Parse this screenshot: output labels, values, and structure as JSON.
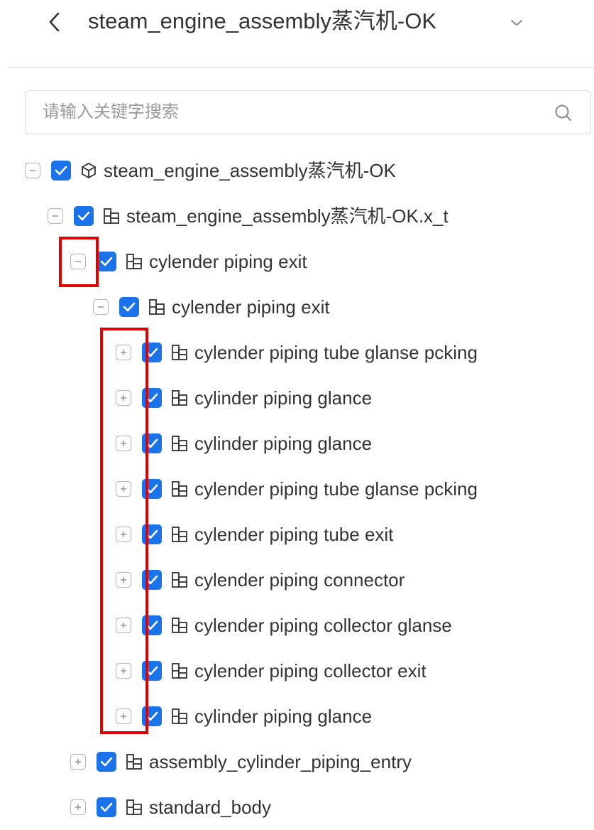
{
  "header": {
    "title": "steam_engine_assembly蒸汽机-OK",
    "back_icon": "chevron-left-icon",
    "dropdown_icon": "chevron-down-icon"
  },
  "search": {
    "placeholder": "请输入关键字搜索",
    "value": "",
    "icon": "search-icon"
  },
  "tree": {
    "checkbox_color": "#1a73e8",
    "highlight_color": "#e30000",
    "nodes": [
      {
        "label": "steam_engine_assembly蒸汽机-OK",
        "level": 0,
        "expanded": true,
        "checked": true,
        "icon": "cube-icon"
      },
      {
        "label": "steam_engine_assembly蒸汽机-OK.x_t",
        "level": 1,
        "expanded": true,
        "checked": true,
        "icon": "assembly-icon"
      },
      {
        "label": "cylender piping exit",
        "level": 2,
        "expanded": true,
        "checked": true,
        "icon": "assembly-icon"
      },
      {
        "label": "cylender piping exit",
        "level": 3,
        "expanded": true,
        "checked": true,
        "icon": "assembly-icon"
      },
      {
        "label": "cylender piping tube glanse pcking",
        "level": 4,
        "expanded": false,
        "checked": true,
        "icon": "assembly-icon"
      },
      {
        "label": "cylinder piping glance",
        "level": 4,
        "expanded": false,
        "checked": true,
        "icon": "assembly-icon"
      },
      {
        "label": "cylinder piping glance",
        "level": 4,
        "expanded": false,
        "checked": true,
        "icon": "assembly-icon"
      },
      {
        "label": "cylender piping tube glanse pcking",
        "level": 4,
        "expanded": false,
        "checked": true,
        "icon": "assembly-icon"
      },
      {
        "label": "cylender piping tube exit",
        "level": 4,
        "expanded": false,
        "checked": true,
        "icon": "assembly-icon"
      },
      {
        "label": "cylender piping connector",
        "level": 4,
        "expanded": false,
        "checked": true,
        "icon": "assembly-icon"
      },
      {
        "label": "cylender piping collector glanse",
        "level": 4,
        "expanded": false,
        "checked": true,
        "icon": "assembly-icon"
      },
      {
        "label": "cylender piping collector exit",
        "level": 4,
        "expanded": false,
        "checked": true,
        "icon": "assembly-icon"
      },
      {
        "label": "cylinder piping glance",
        "level": 4,
        "expanded": false,
        "checked": true,
        "icon": "assembly-icon"
      },
      {
        "label": "assembly_cylinder_piping_entry",
        "level": 2,
        "expanded": false,
        "checked": true,
        "icon": "assembly-icon"
      },
      {
        "label": "standard_body",
        "level": 2,
        "expanded": false,
        "checked": true,
        "icon": "assembly-icon"
      }
    ]
  }
}
